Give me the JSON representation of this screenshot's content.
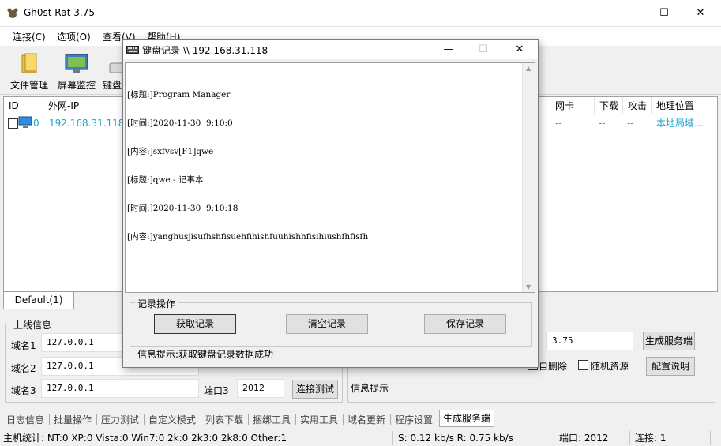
{
  "main": {
    "title": "Gh0st Rat 3.75",
    "win_min": "—",
    "win_max": "☐",
    "win_close": "✕"
  },
  "menu": [
    "连接(C)",
    "选项(O)",
    "查看(V)",
    "帮助(H)"
  ],
  "toolbar": [
    {
      "label": "文件管理",
      "icon": "folder-icon"
    },
    {
      "label": "屏幕监控",
      "icon": "monitor-icon"
    },
    {
      "label": "键盘",
      "icon": "keyboard-icon"
    }
  ],
  "host_list": {
    "columns": [
      "ID",
      "外网-IP",
      "",
      "网卡",
      "下载",
      "攻击",
      "地理位置"
    ],
    "rows": [
      {
        "id": "0",
        "ip": "192.168.31.118",
        "nic": "--",
        "download": "--",
        "attack": "--",
        "location": "本地局域..."
      }
    ]
  },
  "tabs": {
    "default": "Default(1)"
  },
  "online": {
    "title": "上线信息",
    "domain1_label": "域名1",
    "domain1_value": "127.0.0.1",
    "domain2_label": "域名2",
    "domain2_value": "127.0.0.1",
    "domain3_label": "域名3",
    "domain3_value": "127.0.0.1",
    "port3_label": "端口3",
    "port3_value": "2012",
    "test_button": "连接测试",
    "version_value": "3.75",
    "generate_button": "生成服务端",
    "config_help_button": "配置说明",
    "self_delete_label": "自删除",
    "random_resource_label": "随机资源",
    "info_hint": "信息提示"
  },
  "bottom_tabs": [
    "日志信息",
    "批量操作",
    "压力测试",
    "自定义模式",
    "列表下载",
    "捆绑工具",
    "实用工具",
    "域名更新",
    "程序设置",
    "生成服务端"
  ],
  "status": {
    "stats": "主机统计:  NT:0  XP:0  Vista:0  Win7:0  2k:0  2k3:0  2k8:0  Other:1",
    "speed": "S: 0.12 kb/s R: 0.75 kb/s",
    "port": "端口: 2012",
    "connections": "连接: 1"
  },
  "dialog": {
    "title": "键盘记录 \\\\ 192.168.31.118",
    "log": [
      "[标题:]Program Manager",
      "[时间:]2020-11-30  9:10:0",
      "[内容:]sxfvsv[F1]qwe",
      "[标题:]qwe - 记事本",
      "[时间:]2020-11-30  9:10:18",
      "[内容:]yanghusjisufhshfisuehfihishfuuhishhfisihiushfhfisfh"
    ],
    "group_title": "记录操作",
    "get_button": "获取记录",
    "clear_button": "清空记录",
    "save_button": "保存记录",
    "info_text": "信息提示:获取键盘记录数据成功"
  },
  "colors": {
    "link_blue": "#1aa3d6"
  }
}
